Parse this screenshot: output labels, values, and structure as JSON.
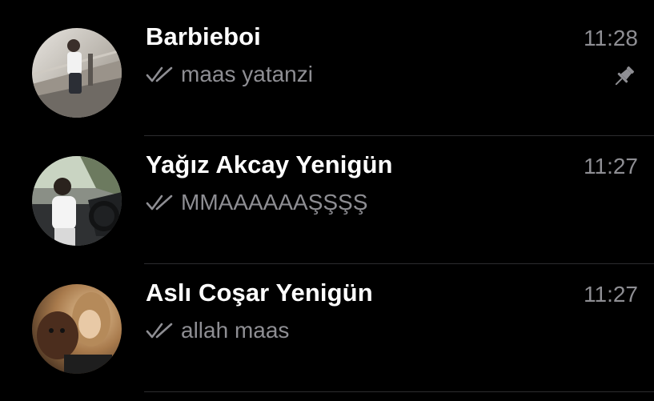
{
  "colors": {
    "background": "#000000",
    "name_text": "#ffffff",
    "secondary_text": "#8e8e93",
    "divider": "#2c2c2e"
  },
  "chats": [
    {
      "name": "Barbieboi",
      "time": "11:28",
      "preview": "maas yatanzi",
      "status_icon": "double-check-icon",
      "pinned": true,
      "pin_icon": "pin-icon"
    },
    {
      "name": "Yağız Akcay Yenigün",
      "time": "11:27",
      "preview": "MMAAAAAAŞŞŞŞ",
      "status_icon": "double-check-icon",
      "pinned": false
    },
    {
      "name": "Aslı Coşar Yenigün",
      "time": "11:27",
      "preview": "allah maas",
      "status_icon": "double-check-icon",
      "pinned": false
    }
  ]
}
